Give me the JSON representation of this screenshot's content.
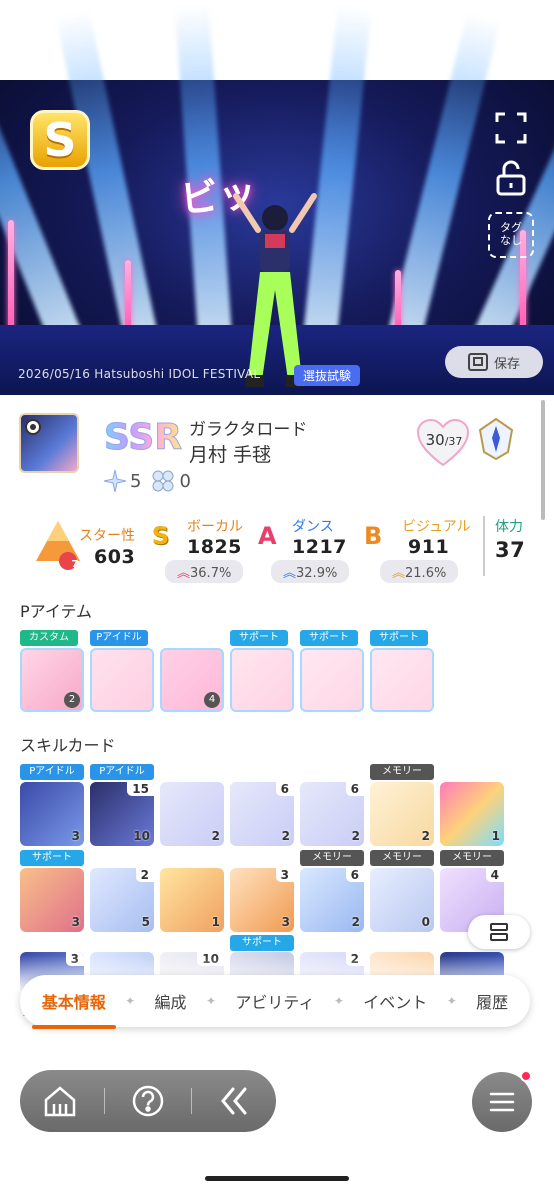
{
  "stage": {
    "rank": "S",
    "tag_label": [
      "タグ",
      "なし"
    ],
    "save_label": "保存",
    "caption": "2026/05/16  Hatsuboshi IDOL FESTIVAL",
    "caption_tag": "選抜試験",
    "neon_sign": "ビッ"
  },
  "profile": {
    "rarity": "SSR",
    "card_name": "ガラクタロード",
    "character_name": "月村 手毬",
    "star_count": "5",
    "clover_count": "0",
    "level_current": "30",
    "level_max": "37"
  },
  "stats": {
    "star": {
      "label": "スター性",
      "value": "603",
      "rank": "7"
    },
    "vocal": {
      "grade": "S",
      "label": "ボーカル",
      "value": "1825",
      "pct": "36.7%",
      "color": "#e8801a"
    },
    "dance": {
      "grade": "A",
      "label": "ダンス",
      "value": "1217",
      "pct": "32.9%",
      "color": "#2a7de8"
    },
    "visual": {
      "grade": "B",
      "label": "ビジュアル",
      "value": "911",
      "pct": "21.6%",
      "color": "#e8a020"
    },
    "stamina": {
      "label": "体力",
      "value": "37"
    }
  },
  "p_items": {
    "title": "Pアイテム",
    "items": [
      {
        "badge": "カスタム",
        "badge_type": "custom",
        "count": "2"
      },
      {
        "badge": "Pアイドル",
        "badge_type": "pidol",
        "count": ""
      },
      {
        "badge": "",
        "badge_type": "",
        "count": "4"
      },
      {
        "badge": "サポート",
        "badge_type": "support",
        "count": ""
      },
      {
        "badge": "サポート",
        "badge_type": "support",
        "count": ""
      },
      {
        "badge": "サポート",
        "badge_type": "support",
        "count": ""
      }
    ]
  },
  "skill_cards": {
    "title": "スキルカード",
    "row1": [
      {
        "badge": "Pアイドル",
        "corner": "",
        "cost": "3"
      },
      {
        "badge": "Pアイドル",
        "corner": "15",
        "cost": "10"
      },
      {
        "badge": "",
        "corner": "",
        "cost": "2"
      },
      {
        "badge": "",
        "corner": "6",
        "cost": "2"
      },
      {
        "badge": "",
        "corner": "6",
        "cost": "2"
      },
      {
        "badge": "メモリー",
        "corner": "",
        "cost": "2"
      },
      {
        "badge": "",
        "corner": "",
        "cost": "1"
      }
    ],
    "row2": [
      {
        "badge": "サポート",
        "corner": "",
        "cost": "3"
      },
      {
        "badge": "",
        "corner": "2",
        "cost": "5"
      },
      {
        "badge": "",
        "corner": "",
        "cost": "1"
      },
      {
        "badge": "",
        "corner": "3",
        "cost": "3"
      },
      {
        "badge": "メモリー",
        "corner": "6",
        "cost": "2"
      },
      {
        "badge": "メモリー",
        "corner": "",
        "cost": "0"
      },
      {
        "badge": "メモリー",
        "corner": "4",
        "cost": ""
      }
    ],
    "row3": [
      {
        "badge": "",
        "corner": "3"
      },
      {
        "badge": "",
        "corner": ""
      },
      {
        "badge": "",
        "corner": "10"
      },
      {
        "badge": "サポート",
        "corner": ""
      },
      {
        "badge": "",
        "corner": "2"
      },
      {
        "badge": "",
        "corner": ""
      },
      {
        "badge": "",
        "corner": ""
      }
    ]
  },
  "tabs": [
    "基本情報",
    "編成",
    "アビリティ",
    "イベント",
    "履歴"
  ],
  "active_tab": "基本情報",
  "icons": {
    "fullscreen": "fullscreen-icon",
    "lock": "unlock-icon",
    "home": "home-icon",
    "help": "help-icon",
    "back": "back-icon",
    "menu": "menu-icon",
    "layout": "layout-toggle-icon"
  }
}
